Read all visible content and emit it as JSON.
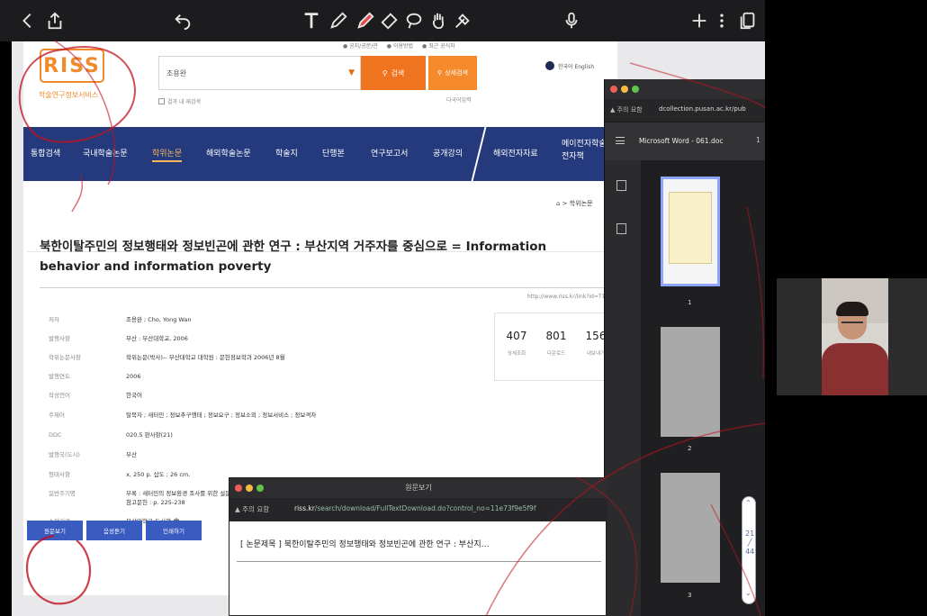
{
  "toolbar": {
    "icons": [
      "chevron-left-icon",
      "share-icon",
      "undo-icon",
      "text-tool-icon",
      "pen-icon",
      "marker-icon",
      "eraser-icon",
      "lasso-icon",
      "hand-icon",
      "laser-pointer-icon",
      "microphone-icon",
      "plus-icon",
      "more-icon",
      "pages-icon"
    ]
  },
  "riss": {
    "logo": "RISS",
    "logo_sub": "학술연구정보서비스",
    "top_links": [
      "● 공지/공문/관",
      "● 이용방법",
      "● 최근 공식자"
    ],
    "search_value": "조용완",
    "search_button": "검색",
    "detail_button": "상세검색",
    "in_result_label": "결과 내 재검색",
    "multi_lang": "다국어입력",
    "lang_label": "한국어 English",
    "nav": [
      "통합검색",
      "국내학술논문",
      "학위논문",
      "해외학술논문",
      "학술지",
      "단행본",
      "연구보고서",
      "공개강의",
      "해외전자자료",
      "메이전자학술나 전자책"
    ]
  },
  "article": {
    "breadcrumb": "⌂ > 학위논문",
    "title": "북한이탈주민의 정보행태와 정보빈곤에 관한 연구 : 부산지역 거주자를 중심으로 = Information behavior and information poverty",
    "url": "http://www.riss.kr/link?id=T10722",
    "meta": [
      {
        "label": "저자",
        "value": "조용완 ; Cho, Yong Wan"
      },
      {
        "label": "발행사항",
        "value": "부산 : 부산대학교, 2006"
      },
      {
        "label": "학위논문사항",
        "value": "학위논문(박사)-- 부산대학교 대학원 : 문헌정보학과 2006년 8월"
      },
      {
        "label": "발행연도",
        "value": "2006"
      },
      {
        "label": "작성언어",
        "value": "한국어"
      },
      {
        "label": "주제어",
        "value": "탈북자 ; 새터민 ; 정보추구행태 ; 정보요구 ; 정보소외 ; 정보서비스 ; 정보격차"
      },
      {
        "label": "DDC",
        "value": "020.5 판사항(21)"
      },
      {
        "label": "발행국(도시)",
        "value": "부산"
      },
      {
        "label": "형태사항",
        "value": "x, 250 p. 삽도 ; 26 cm."
      },
      {
        "label": "일반주기명",
        "value": "부록 : 새터민의 정보환경 조사를 위한 설문지"
      },
      {
        "label": "",
        "value": "참고문헌 : p. 225-238"
      },
      {
        "label": "소장기관",
        "value": "부산대학교 도서관 🏛"
      }
    ],
    "stats": [
      {
        "value": "407",
        "label": "상세조회"
      },
      {
        "value": "801",
        "label": "다운로드"
      },
      {
        "value": "156",
        "label": "내보내기"
      }
    ],
    "buttons": [
      "원문보기",
      "음성듣기",
      "인쇄하기"
    ]
  },
  "pdf": {
    "warning": "▲ 주의 요함",
    "url": "dcollection.pusan.ac.kr/pub",
    "doc_title": "Microsoft Word - 061.doc",
    "page_indicator": "1",
    "thumbs": [
      "1",
      "2",
      "3"
    ],
    "scroll": {
      "up": "⌃",
      "current": "21",
      "sep": "╱",
      "total": "44",
      "down": "⌄"
    }
  },
  "popup": {
    "title": "원문보기",
    "warning": "▲ 주의 요함",
    "url_host": "riss.kr",
    "url_path": "/search/download/FullTextDownload.do?control_no=11e73f9e5f9f",
    "body": "[ 논문제목 ] 북한이탈주민의 정보행태와 정보빈곤에 관한 연구 : 부산지…"
  },
  "colors": {
    "riss_orange": "#f0731f",
    "nav_blue": "#253a7c",
    "ink_red": "#c1121f"
  }
}
